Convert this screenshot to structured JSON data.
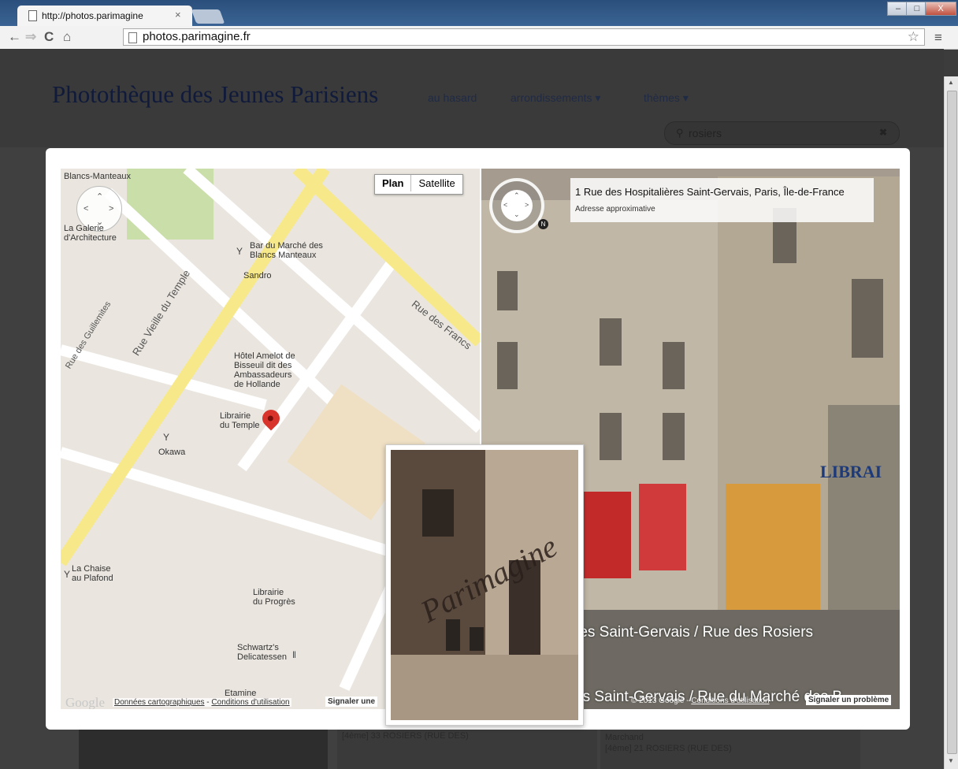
{
  "browser": {
    "tab_title": "http://photos.parimagine",
    "tab_close": "×",
    "url": "photos.parimagine.fr",
    "win_min": "–",
    "win_max": "□",
    "win_close": "X"
  },
  "site": {
    "title": "Photothèque des Jeunes Parisiens",
    "nav": [
      "au hasard",
      "arrondissements ▾",
      "thèmes ▾"
    ],
    "search_value": "rosiers",
    "search_clear": "✖",
    "background_cards": [
      {
        "title": "",
        "subtitle": "[4ème] 33 ROSIERS (RUE DES)"
      },
      {
        "title": "Marchand",
        "subtitle": "[4ème] 21 ROSIERS (RUE DES)"
      }
    ]
  },
  "map": {
    "type_buttons": [
      "Plan",
      "Satellite"
    ],
    "labels": [
      "Blancs-Manteaux",
      "La Galerie\nd'Architecture",
      "Bar du Marché des\nBlancs Manteaux",
      "Sandro",
      "Hôtel Amelot de\nBisseuil dit des\nAmbassadeurs\nde Hollande",
      "Librairie\ndu Temple",
      "Okawa",
      "La Chaise\nau Plafond",
      "Librairie\ndu Progrès",
      "Schwartz's\nDelicatessen",
      "Etamine"
    ],
    "streets": [
      "Rue Vieille du Temple",
      "Rue des Francs",
      "Rue des Guillemites"
    ],
    "footer_logo": "Google",
    "footer_data": "Données cartographiques",
    "footer_sep": " - ",
    "footer_terms": "Conditions d'utilisation",
    "footer_report": "Signaler une"
  },
  "streetview": {
    "address": "1 Rue des Hospitalières Saint-Gervais, Paris, Île-de-France",
    "address_note": "Adresse approximative",
    "street_labels": [
      "res Saint-Gervais / Rue des Rosiers",
      "es Saint-Gervais / Rue du Marché des B"
    ],
    "shop_sign": "LIBRAI",
    "footer_copy": "© 2013 Google - ",
    "footer_terms": "Conditions d'utilisation",
    "footer_report": "Signaler un problème",
    "compass_n": "N"
  },
  "photo": {
    "watermark": "Parimagine"
  },
  "colors": {
    "accent": "#d9342b",
    "map_bg": "#eae6df",
    "major_road": "#f7e98a"
  }
}
